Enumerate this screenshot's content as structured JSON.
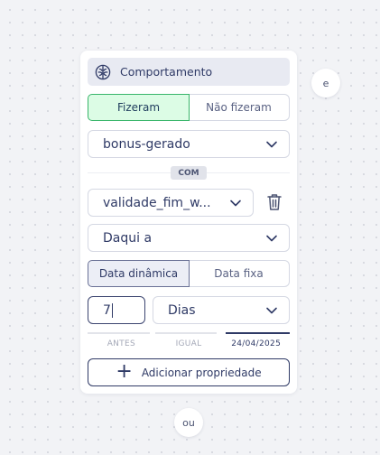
{
  "header": {
    "title": "Comportamento",
    "icon": "brain-icon"
  },
  "action_toggle": {
    "options": [
      "Fizeram",
      "Não fizeram"
    ],
    "selected": "Fizeram"
  },
  "event_select": {
    "value": "bonus-gerado"
  },
  "connector_badge": "COM",
  "property_select": {
    "value": "validade_fim_w..."
  },
  "operator_select": {
    "value": "Daqui a"
  },
  "date_mode_toggle": {
    "options": [
      "Data dinâmica",
      "Data fixa"
    ],
    "selected": "Data dinâmica"
  },
  "amount_input": {
    "value": "7"
  },
  "unit_select": {
    "value": "Dias"
  },
  "comparison_tabs": {
    "items": [
      "ANTES",
      "IGUAL",
      "24/04/2025"
    ],
    "active": "24/04/2025"
  },
  "add_property_button": {
    "label": "Adicionar propriedade"
  },
  "and_connector": "e",
  "or_connector": "ou",
  "colors": {
    "accent": "#2f3a66",
    "success_bg": "#dcfce5",
    "success_border": "#38b56a"
  }
}
